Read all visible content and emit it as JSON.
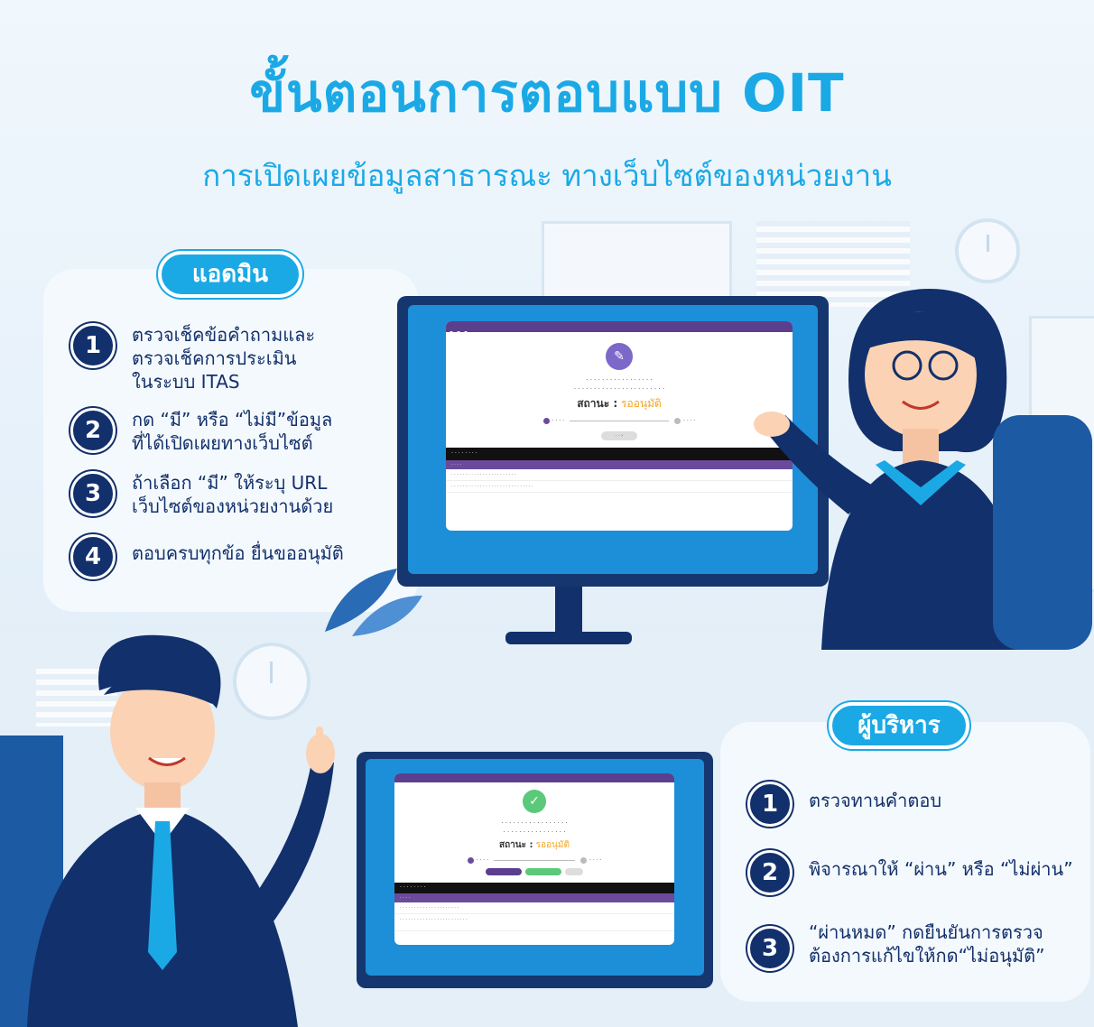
{
  "title": "ขั้นตอนการตอบแบบ OIT",
  "subtitle": "การเปิดเผยข้อมูลสาธารณะ ทางเว็บไซต์ของหน่วยงาน",
  "colors": {
    "accent": "#1ba9e6",
    "navy": "#12306b",
    "panel": "#f4f9fd",
    "screen_header": "#5b3f8e"
  },
  "admin": {
    "label": "แอดมิน",
    "steps": [
      {
        "num": "1",
        "text": "ตรวจเช็คข้อคำถามและ\nตรวจเช็คการประเมิน\nในระบบ ITAS"
      },
      {
        "num": "2",
        "text": "กด “มี” หรือ “ไม่มี”ข้อมูล\nที่ได้เปิดเผยทางเว็บไซต์"
      },
      {
        "num": "3",
        "text": "ถ้าเลือก “มี” ให้ระบุ URL\nเว็บไซต์ของหน่วยงานด้วย"
      },
      {
        "num": "4",
        "text": "ตอบครบทุกข้อ ยื่นขออนุมัติ"
      }
    ]
  },
  "executive": {
    "label": "ผู้บริหาร",
    "steps": [
      {
        "num": "1",
        "text": "ตรวจทานคำตอบ"
      },
      {
        "num": "2",
        "text": "พิจารณาให้ “ผ่าน” หรือ “ไม่ผ่าน”"
      },
      {
        "num": "3",
        "text": "“ผ่านหมด” กดยืนยันการตรวจ\nต้องการแก้ไขให้กด“ไม่อนุมัติ”"
      }
    ]
  },
  "screens": [
    {
      "logo_icon": "pencil-icon",
      "status_label": "สถานะ :",
      "status_value": "รออนุมัติ"
    },
    {
      "logo_icon": "check-icon",
      "status_label": "สถานะ :",
      "status_value": "รออนุมัติ"
    }
  ]
}
